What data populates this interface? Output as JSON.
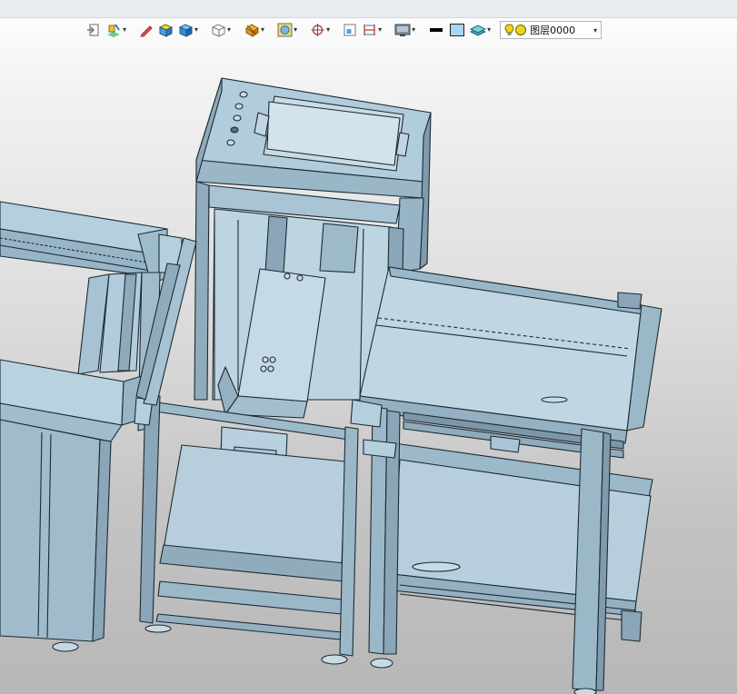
{
  "toolbar": {
    "buttons": [
      {
        "icon": "exit-view-icon",
        "dropdown": false
      },
      {
        "icon": "render-style-icon",
        "dropdown": true
      },
      {
        "icon": "edge-pen-icon",
        "dropdown": false
      },
      {
        "icon": "shaded-cube-icon",
        "dropdown": false
      },
      {
        "icon": "blue-cube-icon",
        "dropdown": true
      },
      {
        "icon": "wireframe-cube-icon",
        "dropdown": true
      },
      {
        "icon": "section-view-icon",
        "dropdown": true
      },
      {
        "icon": "zoom-fit-icon",
        "dropdown": true
      },
      {
        "icon": "target-snap-icon",
        "dropdown": true
      },
      {
        "icon": "window-select-icon",
        "dropdown": false
      },
      {
        "icon": "dimension-icon",
        "dropdown": true
      },
      {
        "icon": "display-icon",
        "dropdown": true
      },
      {
        "icon": "line-weight-icon",
        "dropdown": false
      },
      {
        "icon": "fill-color-icon",
        "dropdown": false
      },
      {
        "icon": "layers-icon",
        "dropdown": true
      }
    ],
    "dropdown_glyph": "▾",
    "layer": {
      "name": "图层0000",
      "bulb_color": "#f2d21a",
      "dot_color": "#e8d81f",
      "arrow": "▾"
    }
  },
  "viewport": {
    "model_color": "#a9c5d6",
    "edge_color": "#1c2a33",
    "background_top": "#ffffff",
    "background_bottom": "#b7b7b7"
  }
}
